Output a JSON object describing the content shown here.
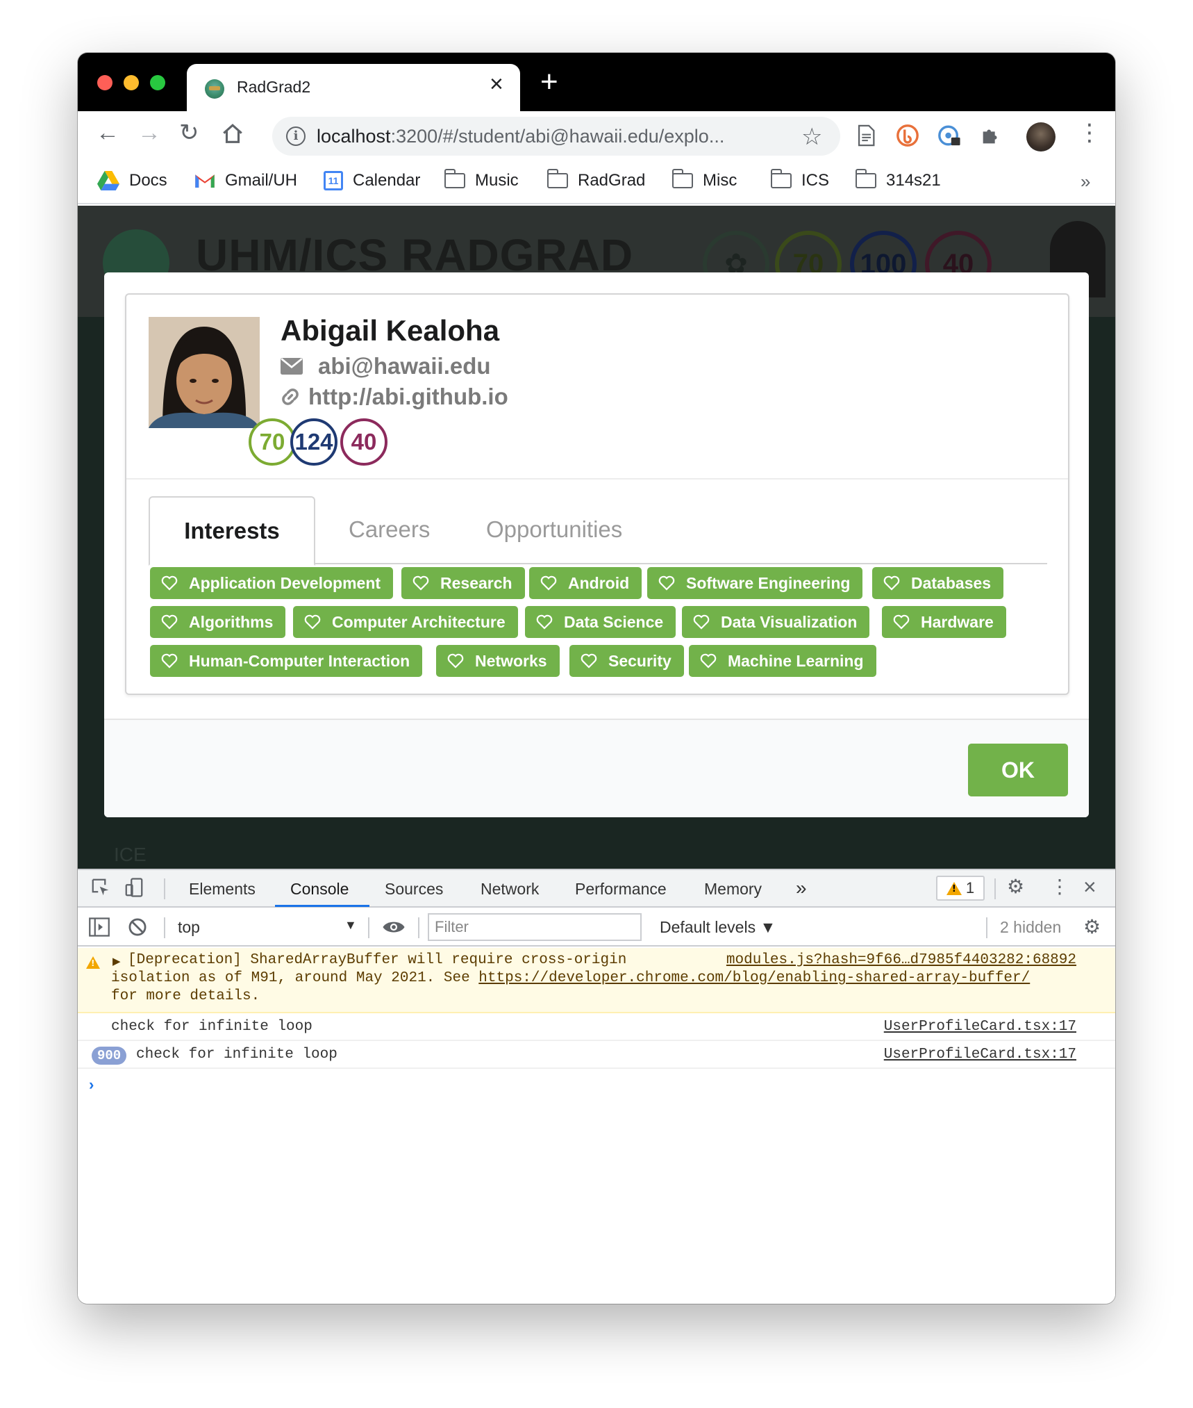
{
  "browser": {
    "tab_title": "RadGrad2",
    "url_host": "localhost",
    "url_rest": ":3200/#/student/abi@hawaii.edu/explo...",
    "bookmarks": [
      "Docs",
      "Gmail/UH",
      "Calendar",
      "Music",
      "RadGrad",
      "Misc",
      "ICS",
      "314s21"
    ],
    "calendar_day": "11"
  },
  "background_page": {
    "title": "UHM/ICS RADGRAD",
    "levels": [
      "70",
      "100",
      "40"
    ],
    "label": "ICE"
  },
  "profile": {
    "name": "Abigail Kealoha",
    "email": "abi@hawaii.edu",
    "website": "http://abi.github.io",
    "ice": {
      "innovation": "70",
      "competency": "124",
      "experience": "40"
    },
    "colors": {
      "innovation": "#7cab32",
      "competency": "#1f3a73",
      "experience": "#8c2a5c",
      "chip": "#72b24a"
    }
  },
  "tabs": {
    "active": "Interests",
    "careers": "Careers",
    "opportunities": "Opportunities"
  },
  "interests": [
    "Application Development",
    "Research",
    "Android",
    "Software Engineering",
    "Databases",
    "Algorithms",
    "Computer Architecture",
    "Data Science",
    "Data Visualization",
    "Hardware",
    "Human-Computer Interaction",
    "Networks",
    "Security",
    "Machine Learning"
  ],
  "modal": {
    "ok_label": "OK"
  },
  "devtools": {
    "tabs": [
      "Elements",
      "Console",
      "Sources",
      "Network",
      "Performance",
      "Memory"
    ],
    "warning_count": "1",
    "context": "top",
    "filter_placeholder": "Filter",
    "levels": "Default levels ▼",
    "hidden": "2 hidden",
    "warning": {
      "line1": "[Deprecation] SharedArrayBuffer will require cross-origin",
      "line2_prefix": "isolation as of M91, around May 2021. See ",
      "line2_link": "https://developer.chrome.com/blog/enabling-shared-array-buffer/",
      "line3": "for more details.",
      "source": "modules.js?hash=9f66…d7985f4403282:68892"
    },
    "messages": [
      {
        "text": "check for infinite loop",
        "source": "UserProfileCard.tsx:17",
        "repeat": ""
      },
      {
        "text": "check for infinite loop",
        "source": "UserProfileCard.tsx:17",
        "repeat": "900"
      }
    ]
  }
}
